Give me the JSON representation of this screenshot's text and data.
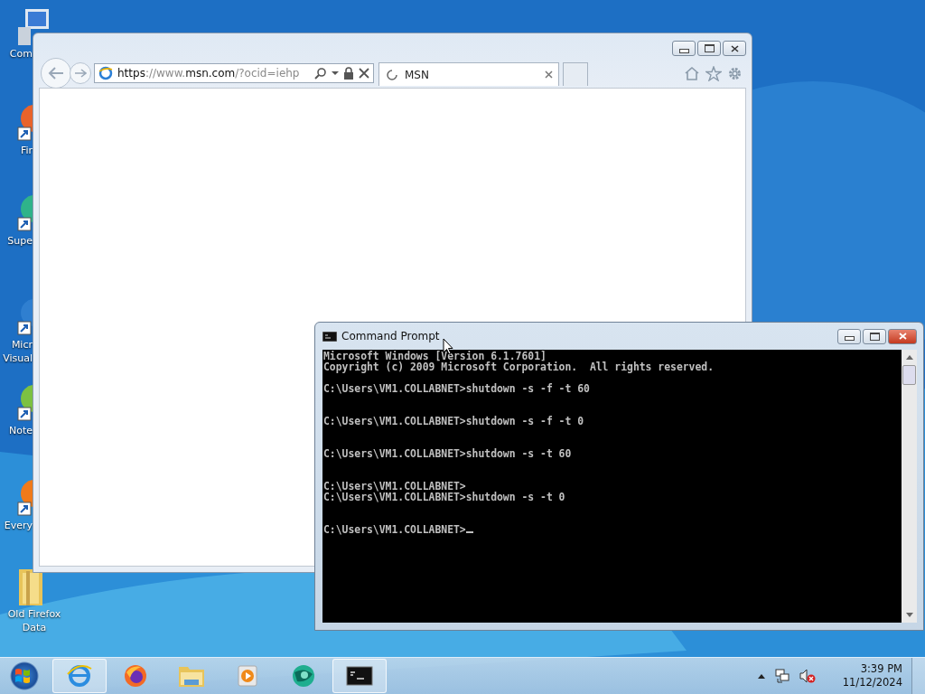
{
  "desktop_icons": [
    {
      "label": "Com",
      "kind": "computer"
    },
    {
      "label": "Fir",
      "kind": "firefox"
    },
    {
      "label": "Supe",
      "kind": "globe"
    },
    {
      "label": "Micr\nVisual",
      "kind": "edge"
    },
    {
      "label": "Note",
      "kind": "notepad"
    },
    {
      "label": "Every",
      "kind": "search"
    },
    {
      "label": "Old Firefox\nData",
      "kind": "folder"
    }
  ],
  "browser": {
    "address": [
      {
        "text": "https",
        "dim": false
      },
      {
        "text": "://www.",
        "dim": true
      },
      {
        "text": "msn.com",
        "dim": false
      },
      {
        "text": "/?ocid=iehp",
        "dim": true
      }
    ],
    "tabs": [
      {
        "label": "MSN",
        "selected": true
      }
    ]
  },
  "console": {
    "title": "Command Prompt",
    "output": "Microsoft Windows [Version 6.1.7601]\nCopyright (c) 2009 Microsoft Corporation.  All rights reserved.\n\nC:\\Users\\VM1.COLLABNET>shutdown -s -f -t 60\n\n\nC:\\Users\\VM1.COLLABNET>shutdown -s -f -t 0\n\n\nC:\\Users\\VM1.COLLABNET>shutdown -s -t 60\n\n\nC:\\Users\\VM1.COLLABNET>\nC:\\Users\\VM1.COLLABNET>shutdown -s -t 0\n\n\nC:\\Users\\VM1.COLLABNET>"
  },
  "taskbar": {
    "items": [
      {
        "kind": "ie",
        "active": true
      },
      {
        "kind": "firefox",
        "active": false
      },
      {
        "kind": "folder",
        "active": false
      },
      {
        "kind": "media",
        "active": false
      },
      {
        "kind": "globe",
        "active": false
      },
      {
        "kind": "cmd",
        "active": true
      }
    ],
    "clock": {
      "time": "3:39 PM",
      "date": "11/12/2024"
    }
  }
}
